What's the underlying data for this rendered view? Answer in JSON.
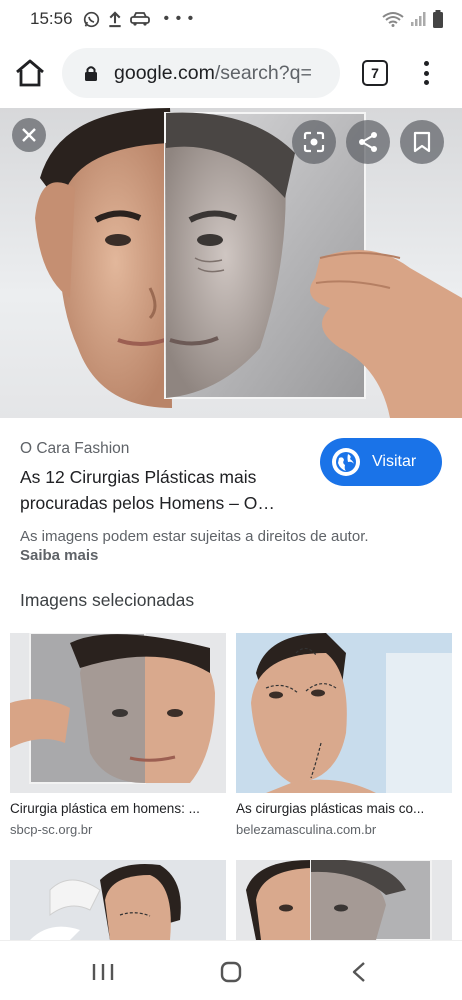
{
  "status": {
    "time": "15:56",
    "icons_left": [
      "whatsapp-icon",
      "upload-icon",
      "car-icon",
      "more-dots-icon"
    ],
    "icons_right": [
      "wifi-icon",
      "signal-icon",
      "battery-icon"
    ]
  },
  "browser": {
    "url_host": "google.com",
    "url_path": "/search?q=",
    "tab_count": "7"
  },
  "viewer": {
    "source": "O Cara Fashion",
    "title": "As 12 Cirurgias Plásticas mais procuradas pelos Homens – O…",
    "visit_label": "Visitar",
    "copyright": "As imagens podem estar sujeitas a direitos de autor.",
    "learn_more": "Saiba mais",
    "related_title": "Imagens selecionadas"
  },
  "related": [
    {
      "caption": "Cirurgia plástica em homens: ...",
      "domain": "sbcp-sc.org.br"
    },
    {
      "caption": "As cirurgias plásticas mais co...",
      "domain": "belezamasculina.com.br"
    },
    {
      "caption": "",
      "domain": ""
    },
    {
      "caption": "",
      "domain": ""
    }
  ],
  "colors": {
    "accent": "#1a73e8",
    "overlay": "#5f6368",
    "text_secondary": "#5f6368"
  }
}
